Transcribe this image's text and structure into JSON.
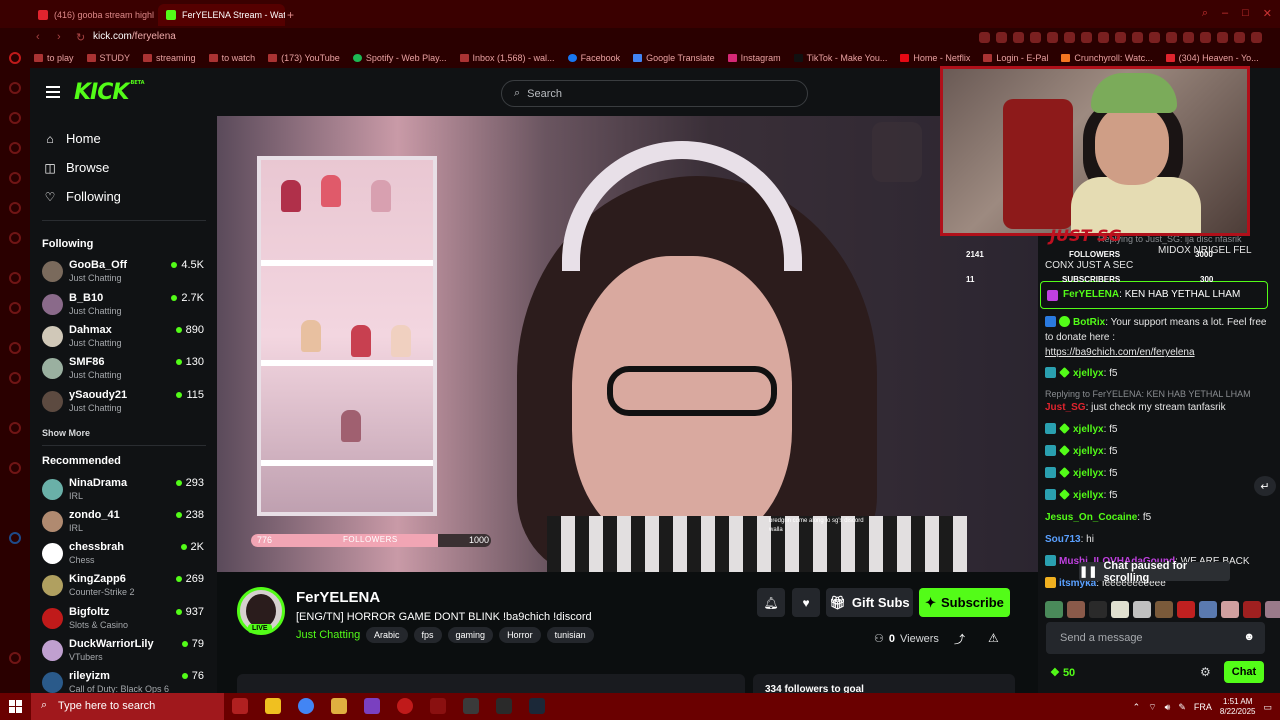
{
  "browser": {
    "tabs": [
      {
        "title": "(416) gooba stream highl",
        "active": false
      },
      {
        "title": "FerYELENA Stream - Wat",
        "active": true
      }
    ],
    "url_host": "kick.com",
    "url_path": "/feryelena",
    "bookmarks": [
      "to play",
      "STUDY",
      "streaming",
      "to watch",
      "(173) YouTube",
      "Spotify - Web Play...",
      "Inbox (1,568) - wal...",
      "Facebook",
      "Google Translate",
      "Instagram",
      "TikTok - Make You...",
      "Home - Netflix",
      "Login - E-Pal",
      "Crunchyroll: Watc...",
      "(304) Heaven - Yo..."
    ]
  },
  "header": {
    "logo": "KICK",
    "logo_sup": "BETA",
    "search_placeholder": "Search"
  },
  "sidebar": {
    "nav": [
      "Home",
      "Browse",
      "Following"
    ],
    "following_heading": "Following",
    "following": [
      {
        "name": "GooBa_Off",
        "category": "Just Chatting",
        "viewers": "4.5K",
        "color": "#7a6a5c"
      },
      {
        "name": "B_B10",
        "category": "Just Chatting",
        "viewers": "2.7K",
        "color": "#8a6a8a"
      },
      {
        "name": "Dahmax",
        "category": "Just Chatting",
        "viewers": "890",
        "color": "#d0c8b8"
      },
      {
        "name": "SMF86",
        "category": "Just Chatting",
        "viewers": "130",
        "color": "#9ab0a0"
      },
      {
        "name": "ySaoudy21",
        "category": "Just Chatting",
        "viewers": "115",
        "color": "#5c4a40"
      }
    ],
    "show_more": "Show More",
    "recommended_heading": "Recommended",
    "recommended": [
      {
        "name": "NinaDrama",
        "category": "IRL",
        "viewers": "293",
        "color": "#6ab0a8"
      },
      {
        "name": "zondo_41",
        "category": "IRL",
        "viewers": "238",
        "color": "#b08a70"
      },
      {
        "name": "chessbrah",
        "category": "Chess",
        "viewers": "2K",
        "color": "#ffffff"
      },
      {
        "name": "KingZapp6",
        "category": "Counter-Strike 2",
        "viewers": "269",
        "color": "#b0a060"
      },
      {
        "name": "Bigfoltz",
        "category": "Slots & Casino",
        "viewers": "937",
        "color": "#c01a1a"
      },
      {
        "name": "DuckWarriorLily",
        "category": "VTubers",
        "viewers": "79",
        "color": "#c0a0d0"
      },
      {
        "name": "rileyizm",
        "category": "Call of Duty: Black Ops 6",
        "viewers": "76",
        "color": "#2a5a8a"
      }
    ]
  },
  "video": {
    "overlay_left_num": "776",
    "overlay_label": "FOLLOWERS",
    "overlay_right_num": "1000",
    "overlay_progress": 0.78,
    "overlay_chat_1": "bredgrin come along to sg's discord",
    "overlay_chat_2": "walla"
  },
  "stream": {
    "name": "FerYELENA",
    "live": "LIVE",
    "title": "[ENG/TN] HORROR GAME DONT BLINK !ba9chich !discord",
    "category": "Just Chatting",
    "tags": [
      "Arabic",
      "fps",
      "gaming",
      "Horror",
      "tunisian"
    ],
    "gift_label": "Gift Subs",
    "subscribe_label": "Subscribe",
    "viewers_count": "0",
    "viewers_label": "Viewers",
    "about_title": "334 followers to goal"
  },
  "chat": {
    "top_line_1": "Replying to Just_SG: ija disc nfasrik",
    "top_line_2": "MIDOX NRIGEL FEL",
    "top_line_3": "CONX JUST A SEC",
    "pinned_user": "FerYELENA",
    "pinned_text": "KEN HAB YETHAL LHAM",
    "messages": [
      {
        "user": "BotRix",
        "text": "Your support means a lot. Feel free to donate here :",
        "color": "#53fc18"
      },
      {
        "user": "xjellyx",
        "text": "f5",
        "color": "#53fc18"
      },
      {
        "reply": "Replying to FerYELENA: KEN HAB YETHAL LHAM"
      },
      {
        "user": "Just_SG",
        "text": "just check my stream tanfasrik",
        "color": "#e0242e"
      },
      {
        "user": "xjellyx",
        "text": "f5",
        "color": "#53fc18"
      },
      {
        "user": "xjellyx",
        "text": "f5",
        "color": "#53fc18"
      },
      {
        "user": "xjellyx",
        "text": "f5",
        "color": "#53fc18"
      },
      {
        "user": "xjellyx",
        "text": "f5",
        "color": "#53fc18"
      },
      {
        "user": "Jesus_On_Cocaine",
        "text": "f5",
        "color": "#53fc18"
      },
      {
        "user": "Sou713",
        "text": "hi",
        "color": "#5aa0ff"
      },
      {
        "user": "Mushi_ILOVHAdaGound",
        "text": "WE ARE BACK",
        "color": "#c040e0"
      },
      {
        "user": "itsmyka",
        "text": "feeeeeeeeeee",
        "color": "#5aa0ff"
      }
    ],
    "botrix_link": "https://ba9chich.com/en/feryelena",
    "paused_label": "Chat paused for scrolling",
    "send_placeholder": "Send a message",
    "points": "50",
    "chat_button": "Chat"
  },
  "webcam": {
    "brand": "JUST SG",
    "followers_label": "FOLLOWERS",
    "followers_count": "2141",
    "followers_goal": "3000",
    "subscribers_label": "SUBSCRIBERS",
    "subscribers_count": "11",
    "subscribers_goal": "300"
  },
  "taskbar": {
    "search_placeholder": "Type here to search",
    "language": "FRA",
    "time": "1:51 AM",
    "date": "8/22/2025"
  }
}
